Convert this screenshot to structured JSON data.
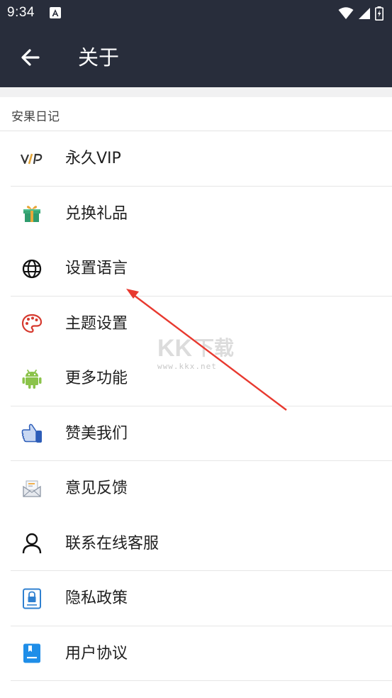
{
  "status_bar": {
    "time": "9:34",
    "icons": [
      "a-notification-icon",
      "wifi-icon",
      "signal-icon",
      "battery-icon"
    ]
  },
  "app_bar": {
    "back_icon": "arrow-left-icon",
    "title": "关于"
  },
  "section": {
    "header": "安果日记"
  },
  "menu": {
    "items": [
      {
        "label": "永久VIP",
        "icon": "vip-icon"
      },
      {
        "label": "兑换礼品",
        "icon": "gift-icon"
      },
      {
        "label": "设置语言",
        "icon": "globe-icon"
      },
      {
        "label": "主题设置",
        "icon": "palette-icon"
      },
      {
        "label": "更多功能",
        "icon": "android-icon"
      },
      {
        "label": "赞美我们",
        "icon": "thumbs-up-icon"
      },
      {
        "label": "意见反馈",
        "icon": "feedback-mail-icon"
      },
      {
        "label": "联系在线客服",
        "icon": "user-icon"
      },
      {
        "label": "隐私政策",
        "icon": "privacy-lock-icon"
      },
      {
        "label": "用户协议",
        "icon": "agreement-doc-icon"
      }
    ]
  },
  "watermark": {
    "text": "KK下载",
    "url": "www.kkx.net"
  },
  "colors": {
    "app_bar_bg": "#282d3b",
    "annotation_arrow": "#e8392f",
    "divider": "#e6e6e6"
  }
}
